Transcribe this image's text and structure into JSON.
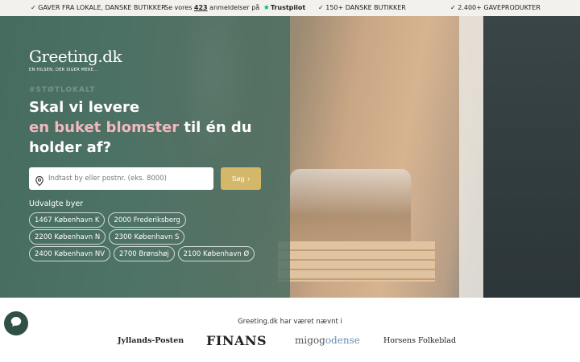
{
  "topbar": {
    "gifts": "✓ GAVER FRA LOKALE, DANSKE BUTIKKER",
    "reviews_prefix": "Se vores",
    "reviews_count": "423",
    "reviews_suffix": "anmeldelser på",
    "trustpilot": "Trustpilot",
    "shops": "✓ 150+ DANSKE BUTIKKER",
    "products": "✓ 2.400+ GAVEPRODUKTER"
  },
  "hero": {
    "logo": "Greeting.dk",
    "tagline": "EN HILSEN, DER SIGER MERE...",
    "hashtag": "#STØTLOKALT",
    "headline_line1": "Skal vi levere",
    "headline_accent": "en buket blomster",
    "headline_rest": " til én du",
    "headline_line3": "holder af?",
    "search_placeholder": "Indtast by eller postnr. (eks. 8000)",
    "search_button": "Søg",
    "cities_title": "Udvalgte byer",
    "cities": [
      "1467 København K",
      "2000 Frederiksberg",
      "2200 København N",
      "2300 København S",
      "2400 København NV",
      "2700 Brønshøj",
      "2100 København Ø"
    ]
  },
  "press": {
    "title": "Greeting.dk har været nævnt i",
    "logos": [
      "Jyllands-Posten",
      "FINANS",
      "migogodense",
      "Horsens Folkeblad"
    ]
  },
  "colors": {
    "accent_pink": "#f4b8c0",
    "button_gold": "#d4b86a",
    "overlay_green": "#486e62",
    "trustpilot_green": "#00b67a"
  },
  "icons": {
    "pin": "map-pin-icon",
    "chat": "chat-bubble-icon",
    "chevron": "chevron-right-icon",
    "star": "trustpilot-star-icon"
  }
}
